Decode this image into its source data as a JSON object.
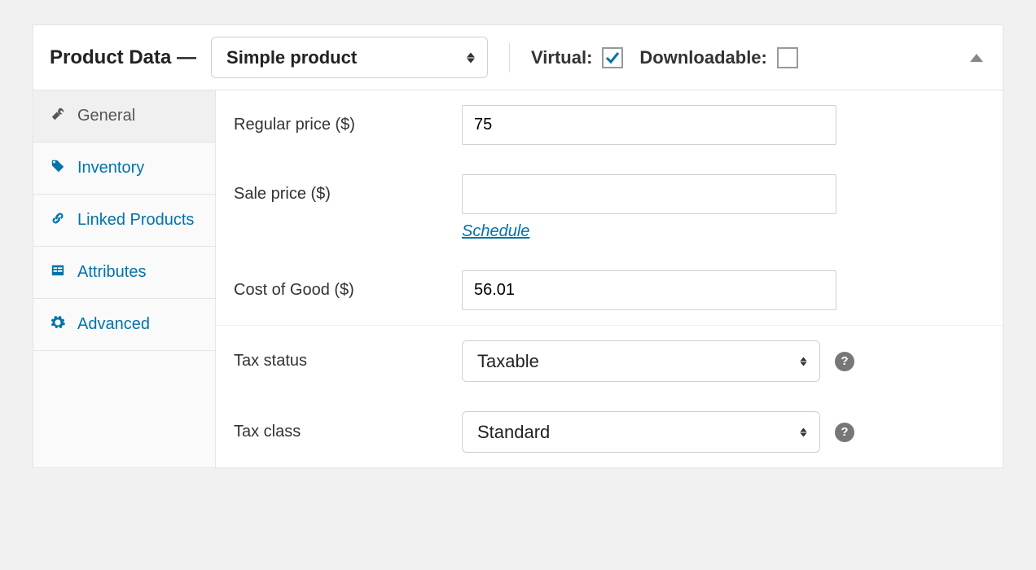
{
  "header": {
    "title_prefix": "Product Data",
    "dash": "—",
    "product_type": "Simple product",
    "virtual_label": "Virtual:",
    "virtual_checked": true,
    "downloadable_label": "Downloadable:",
    "downloadable_checked": false
  },
  "sidebar": {
    "items": [
      {
        "label": "General",
        "icon": "wrench-icon",
        "active": true
      },
      {
        "label": "Inventory",
        "icon": "tag-icon",
        "active": false
      },
      {
        "label": "Linked Products",
        "icon": "link-icon",
        "active": false
      },
      {
        "label": "Attributes",
        "icon": "list-icon",
        "active": false
      },
      {
        "label": "Advanced",
        "icon": "gear-icon",
        "active": false
      }
    ]
  },
  "form": {
    "regular_price_label": "Regular price ($)",
    "regular_price_value": "75",
    "sale_price_label": "Sale price ($)",
    "sale_price_value": "",
    "schedule_label": "Schedule",
    "cost_of_good_label": "Cost of Good ($)",
    "cost_of_good_value": "56.01",
    "tax_status_label": "Tax status",
    "tax_status_value": "Taxable",
    "tax_class_label": "Tax class",
    "tax_class_value": "Standard"
  },
  "colors": {
    "link": "#0073aa",
    "border": "#e5e5e5",
    "bg": "#f1f1f1"
  }
}
